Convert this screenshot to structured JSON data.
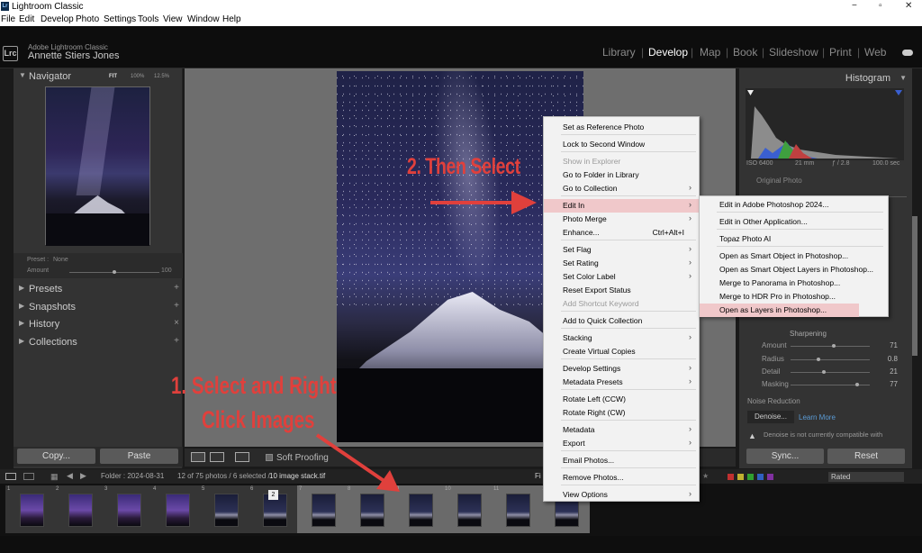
{
  "window": {
    "app_icon": "Lr",
    "title": "Lightroom Classic",
    "controls": [
      "−",
      "▫",
      "✕"
    ]
  },
  "menubar": [
    "File",
    "Edit",
    "Develop",
    "Photo",
    "Settings",
    "Tools",
    "View",
    "Window",
    "Help"
  ],
  "identity": {
    "badge": "Lrc",
    "app_name": "Adobe Lightroom Classic",
    "user": "Annette Stiers Jones"
  },
  "modules": [
    "Library",
    "Develop",
    "Map",
    "Book",
    "Slideshow",
    "Print",
    "Web"
  ],
  "active_module": "Develop",
  "left_panel": {
    "navigator": {
      "title": "Navigator",
      "zoom": [
        "FIT",
        "100%",
        "12.5%"
      ]
    },
    "preset": {
      "preset_label": "Preset :",
      "preset_value": "None",
      "amount_label": "Amount",
      "amount_value": "100",
      "amount_level": 0.95
    },
    "sections": [
      {
        "label": "Presets",
        "action": "+"
      },
      {
        "label": "Snapshots",
        "action": "+"
      },
      {
        "label": "History",
        "action": "×"
      },
      {
        "label": "Collections",
        "action": "+"
      }
    ],
    "buttons": {
      "copy": "Copy...",
      "paste": "Paste"
    }
  },
  "toolbar": {
    "soft_proofing": "Soft Proofing"
  },
  "annotations": {
    "step1_line1": "1. Select and Right",
    "step1_line2": "Click Images",
    "step2": "2. Then Select"
  },
  "context_menu": {
    "items": [
      {
        "label": "Set as Reference Photo"
      },
      {
        "label": "Lock to Second Window"
      },
      {
        "label": "Show in Explorer",
        "disabled": true
      },
      {
        "label": "Go to Folder in Library"
      },
      {
        "label": "Go to Collection",
        "submenu": true
      },
      {
        "label": "Edit In",
        "submenu": true,
        "highlighted": true
      },
      {
        "label": "Photo Merge",
        "submenu": true
      },
      {
        "label": "Enhance...",
        "shortcut": "Ctrl+Alt+I"
      },
      {
        "label": "Set Flag",
        "submenu": true
      },
      {
        "label": "Set Rating",
        "submenu": true
      },
      {
        "label": "Set Color Label",
        "submenu": true
      },
      {
        "label": "Reset Export Status"
      },
      {
        "label": "Add Shortcut Keyword",
        "disabled": true
      },
      {
        "label": "Add to Quick Collection"
      },
      {
        "label": "Stacking",
        "submenu": true
      },
      {
        "label": "Create Virtual Copies"
      },
      {
        "label": "Develop Settings",
        "submenu": true
      },
      {
        "label": "Metadata Presets",
        "submenu": true
      },
      {
        "label": "Rotate Left (CCW)"
      },
      {
        "label": "Rotate Right (CW)"
      },
      {
        "label": "Metadata",
        "submenu": true
      },
      {
        "label": "Export",
        "submenu": true
      },
      {
        "label": "Email Photos..."
      },
      {
        "label": "Remove Photos..."
      },
      {
        "label": "View Options",
        "submenu": true
      }
    ]
  },
  "submenu": {
    "items": [
      {
        "label": "Edit in Adobe Photoshop 2024..."
      },
      {
        "label": "Edit in Other Application..."
      },
      {
        "label": "Topaz Photo AI"
      },
      {
        "label": "Open as Smart Object in Photoshop..."
      },
      {
        "label": "Open as Smart Object Layers in Photoshop..."
      },
      {
        "label": "Merge to Panorama in Photoshop..."
      },
      {
        "label": "Merge to HDR Pro in Photoshop..."
      },
      {
        "label": "Open as Layers in Photoshop...",
        "highlighted": true
      }
    ]
  },
  "right_panel": {
    "histogram": {
      "title": "Histogram",
      "iso": "ISO 6400",
      "focal": "21 mm",
      "aperture": "ƒ / 2.8",
      "shutter": "100.0 sec",
      "original": "Original Photo"
    },
    "sharpening": {
      "title": "Sharpening",
      "rows": [
        {
          "label": "Amount",
          "value": "71",
          "level": 0.55
        },
        {
          "label": "Radius",
          "value": "0.8",
          "level": 0.35
        },
        {
          "label": "Detail",
          "value": "21",
          "level": 0.42
        },
        {
          "label": "Masking",
          "value": "77",
          "level": 0.84
        }
      ]
    },
    "noise": {
      "title": "Noise Reduction",
      "denoise": "Denoise...",
      "learn": "Learn More",
      "warning": "Denoise is not currently compatible with"
    },
    "buttons": {
      "sync": "Sync...",
      "reset": "Reset"
    }
  },
  "filmstrip_bar": {
    "folder": "Folder : 2024-08-31",
    "count": "12 of 75 photos / 6 selected /",
    "file": "10 image stack.tif",
    "filter": "Fi",
    "rated": "Rated"
  },
  "filmstrip": {
    "cells": [
      {
        "num": "1",
        "style": "purple",
        "selected": false
      },
      {
        "num": "2",
        "style": "purple",
        "selected": false
      },
      {
        "num": "3",
        "style": "purple",
        "selected": false
      },
      {
        "num": "4",
        "style": "purple",
        "selected": false
      },
      {
        "num": "5",
        "style": "night",
        "selected": false
      },
      {
        "num": "6",
        "style": "night",
        "selected": false,
        "badge": "2"
      },
      {
        "num": "7",
        "style": "night",
        "selected": true
      },
      {
        "num": "8",
        "style": "night",
        "selected": true
      },
      {
        "num": "9",
        "style": "night",
        "selected": true
      },
      {
        "num": "10",
        "style": "night",
        "selected": true
      },
      {
        "num": "11",
        "style": "night",
        "selected": true
      },
      {
        "num": "12",
        "style": "night",
        "selected": true
      }
    ]
  },
  "colors": {
    "annotation_red": "#e0403c",
    "menu_highlight": "#f0c8ca",
    "panel_bg": "#333333"
  }
}
